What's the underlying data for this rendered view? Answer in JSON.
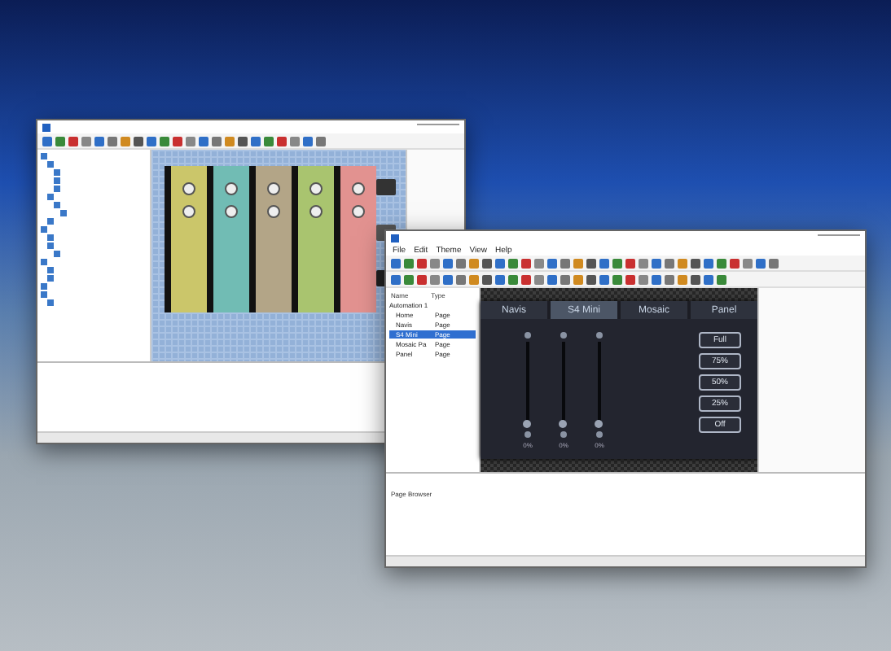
{
  "design_window": {
    "canvas_columns": [
      {
        "color": "#cbc66a"
      },
      {
        "color": "#71bcb4"
      },
      {
        "color": "#b3a587"
      },
      {
        "color": "#a9c46f"
      },
      {
        "color": "#e29290"
      }
    ]
  },
  "touch_window": {
    "menu": [
      "File",
      "Edit",
      "Theme",
      "View",
      "Help"
    ],
    "project_browser": {
      "columns": [
        "Name",
        "Type"
      ],
      "root": "Automation 1",
      "items": [
        {
          "name": "Home",
          "type": "Page",
          "selected": false
        },
        {
          "name": "Navis",
          "type": "Page",
          "selected": false
        },
        {
          "name": "S4 Mini",
          "type": "Page",
          "selected": true
        },
        {
          "name": "Mosaic Pa",
          "type": "Page",
          "selected": false
        },
        {
          "name": "Panel",
          "type": "Page",
          "selected": false
        }
      ]
    },
    "panel": {
      "tabs": [
        {
          "label": "Navis",
          "selected": false
        },
        {
          "label": "S4 Mini",
          "selected": true
        },
        {
          "label": "Mosaic",
          "selected": false
        },
        {
          "label": "Panel",
          "selected": false
        }
      ],
      "sliders": [
        {
          "level": 0,
          "reading": "0%"
        },
        {
          "level": 0,
          "reading": "0%"
        },
        {
          "level": 0,
          "reading": "0%"
        }
      ],
      "buttons": [
        "Full",
        "75%",
        "50%",
        "25%",
        "Off"
      ]
    },
    "page_browser": {
      "title": "Page Browser"
    }
  }
}
